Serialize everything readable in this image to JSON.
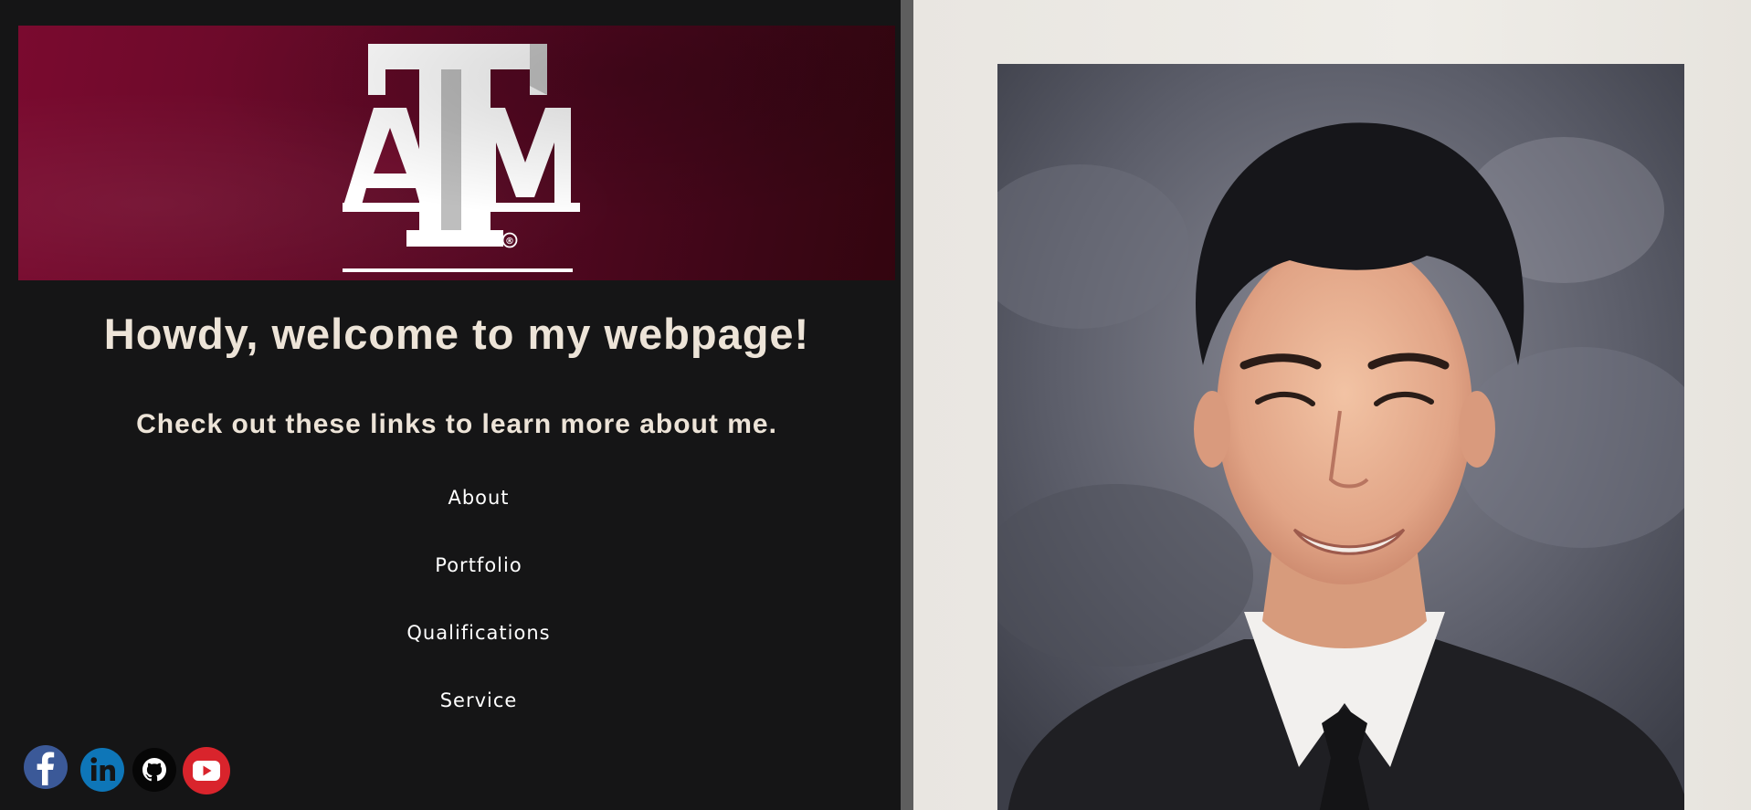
{
  "header": {
    "welcome": "Howdy, welcome to my webpage!",
    "subtitle": "Check out these links to learn more about me."
  },
  "logo": {
    "text": "ATM",
    "trademark": "®"
  },
  "nav": {
    "items": [
      {
        "label": "About"
      },
      {
        "label": "Portfolio"
      },
      {
        "label": "Qualifications"
      },
      {
        "label": "Service"
      }
    ]
  },
  "social": {
    "icons": [
      "facebook-icon",
      "linkedin-icon",
      "github-icon",
      "youtube-icon"
    ]
  },
  "colors": {
    "background": "#151516",
    "banner_maroon": "#6c0a2a",
    "text": "#ede4d8",
    "divider": "#5e5e5e"
  }
}
